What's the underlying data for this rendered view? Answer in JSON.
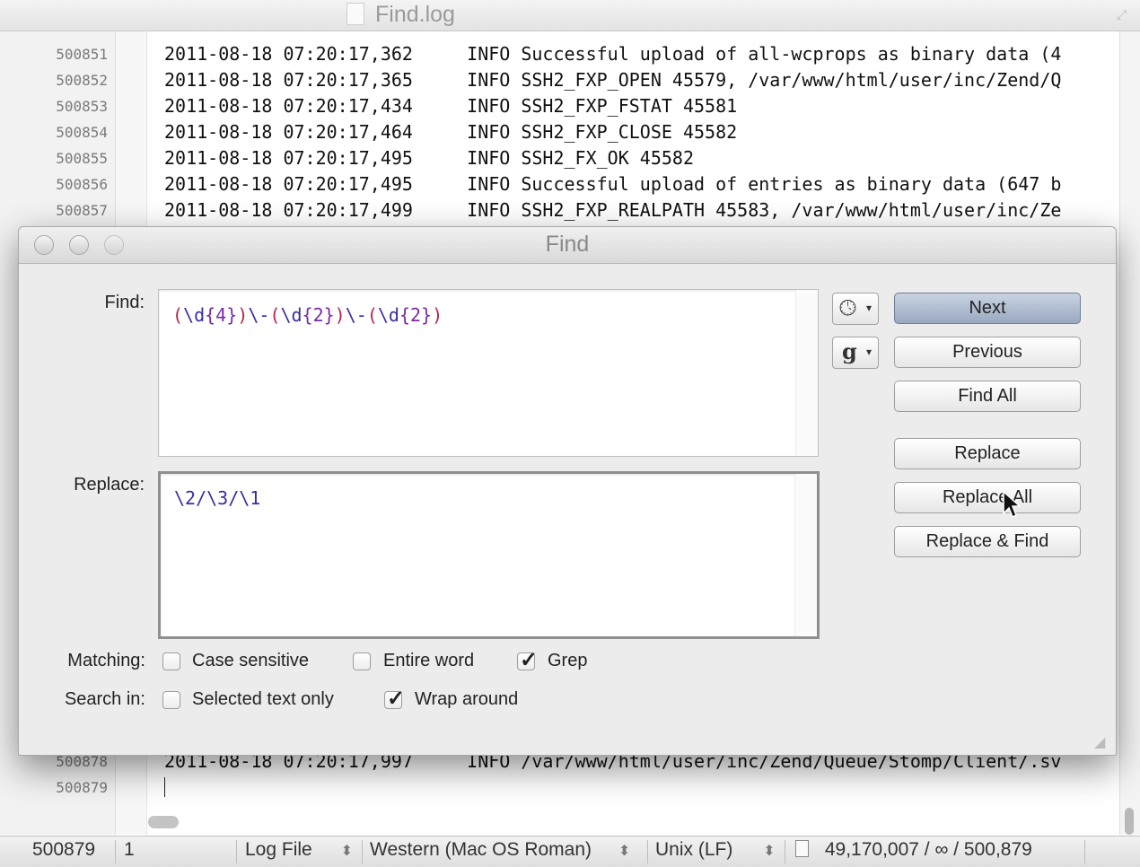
{
  "window": {
    "title": "Find.log"
  },
  "editor": {
    "lines_top": [
      {
        "num": "500851",
        "text": "2011-08-18 07:20:17,362     INFO Successful upload of all-wcprops as binary data (4"
      },
      {
        "num": "500852",
        "text": "2011-08-18 07:20:17,365     INFO SSH2_FXP_OPEN 45579, /var/www/html/user/inc/Zend/Q"
      },
      {
        "num": "500853",
        "text": "2011-08-18 07:20:17,434     INFO SSH2_FXP_FSTAT 45581"
      },
      {
        "num": "500854",
        "text": "2011-08-18 07:20:17,464     INFO SSH2_FXP_CLOSE 45582"
      },
      {
        "num": "500855",
        "text": "2011-08-18 07:20:17,495     INFO SSH2_FX_OK 45582"
      },
      {
        "num": "500856",
        "text": "2011-08-18 07:20:17,495     INFO Successful upload of entries as binary data (647 b"
      },
      {
        "num": "500857",
        "text": "2011-08-18 07:20:17,499     INFO SSH2_FXP_REALPATH 45583, /var/www/html/user/inc/Ze"
      }
    ],
    "lines_bottom": [
      {
        "num": "500878",
        "text": "2011-08-18 07:20:17,997     INFO /var/www/html/user/inc/Zend/Queue/Stomp/Client/.sv"
      },
      {
        "num": "500879",
        "text": ""
      }
    ]
  },
  "status": {
    "line": "500879",
    "col": "1",
    "language": "Log File",
    "encoding": "Western (Mac OS Roman)",
    "line_endings": "Unix (LF)",
    "doc_stats": "49,170,007 / ∞ / 500,879"
  },
  "find_dialog": {
    "title": "Find",
    "find_label": "Find:",
    "find_pattern": [
      {
        "t": "(",
        "c": "#b3244e"
      },
      {
        "t": "\\d",
        "c": "#3a2da0"
      },
      {
        "t": "{4}",
        "c": "#7a2aa8"
      },
      {
        "t": ")",
        "c": "#b3244e"
      },
      {
        "t": "\\-",
        "c": "#3a2da0"
      },
      {
        "t": "(",
        "c": "#b3244e"
      },
      {
        "t": "\\d",
        "c": "#3a2da0"
      },
      {
        "t": "{2}",
        "c": "#7a2aa8"
      },
      {
        "t": ")",
        "c": "#b3244e"
      },
      {
        "t": "\\-",
        "c": "#3a2da0"
      },
      {
        "t": "(",
        "c": "#b3244e"
      },
      {
        "t": "\\d",
        "c": "#3a2da0"
      },
      {
        "t": "{2}",
        "c": "#7a2aa8"
      },
      {
        "t": ")",
        "c": "#b3244e"
      }
    ],
    "replace_label": "Replace:",
    "replace_value": "\\2/\\3/\\1",
    "buttons": {
      "next": "Next",
      "previous": "Previous",
      "find_all": "Find All",
      "replace": "Replace",
      "replace_all": "Replace All",
      "replace_find": "Replace & Find"
    },
    "history_icon": "clock-icon",
    "grep_menu_glyph": "g",
    "matching_label": "Matching:",
    "search_in_label": "Search in:",
    "options": {
      "case_sensitive": {
        "label": "Case sensitive",
        "checked": false
      },
      "entire_word": {
        "label": "Entire word",
        "checked": false
      },
      "grep": {
        "label": "Grep",
        "checked": true
      },
      "selected_text_only": {
        "label": "Selected text only",
        "checked": false
      },
      "wrap_around": {
        "label": "Wrap around",
        "checked": true
      }
    }
  }
}
